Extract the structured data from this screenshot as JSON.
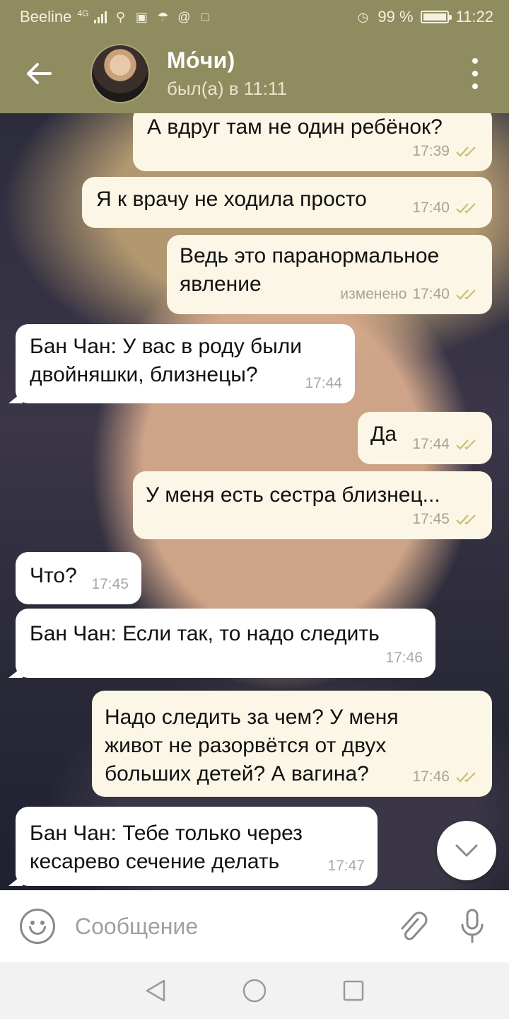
{
  "status_bar": {
    "carrier": "Beeline",
    "network": "4G",
    "battery_percent": "99 %",
    "battery_level": 0.99,
    "time": "11:22"
  },
  "header": {
    "name": "Мо́чи)",
    "status": "был(а) в 11:11"
  },
  "messages": [
    {
      "text": "А вдруг там не один ребёнок?",
      "time": "17:39",
      "edited": ""
    },
    {
      "text": "Я к врачу не ходила просто",
      "time": "17:40",
      "edited": ""
    },
    {
      "text": "Ведь это паранормальное явление",
      "time": "17:40",
      "edited": "изменено"
    },
    {
      "text": "Бан Чан: У вас в роду были двойняшки, близнецы?",
      "time": "17:44",
      "edited": ""
    },
    {
      "text": "Да",
      "time": "17:44",
      "edited": ""
    },
    {
      "text": "У меня есть сестра близнец...",
      "time": "17:45",
      "edited": ""
    },
    {
      "text": "Что?",
      "time": "17:45",
      "edited": ""
    },
    {
      "text": "Бан Чан: Если так, то надо следить",
      "time": "17:46",
      "edited": ""
    },
    {
      "text": "Надо следить за чем? У меня живот не разорвётся от двух больших детей? А вагина?",
      "time": "17:46",
      "edited": ""
    },
    {
      "text": "Бан Чан: Тебе только через кесарево сечение делать",
      "time": "17:47",
      "edited": ""
    }
  ],
  "input": {
    "placeholder": "Сообщение"
  },
  "icons": {
    "back": "arrow-left-icon",
    "menu": "more-vert-icon",
    "scroll": "chevron-down-icon",
    "emoji": "emoji-icon",
    "attach": "paperclip-icon",
    "mic": "microphone-icon"
  },
  "colors": {
    "header": "#8f8c60",
    "outgoing_bubble": "#fbf6e6",
    "incoming_bubble": "#ffffff",
    "read_ticks": "#c9bf73"
  }
}
